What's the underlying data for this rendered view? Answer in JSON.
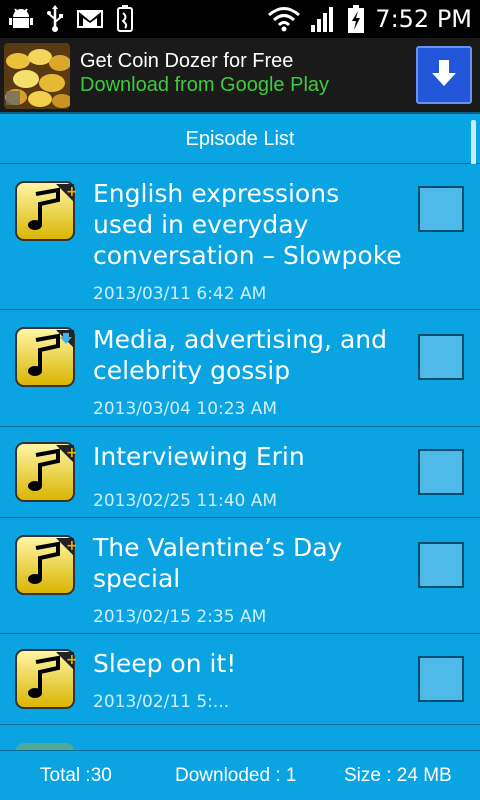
{
  "status_bar": {
    "time": "7:52 PM",
    "icons": [
      "android-debug-icon",
      "usb-icon",
      "gmail-icon",
      "battery-saver-icon",
      "wifi-icon",
      "signal-icon",
      "battery-charging-icon"
    ]
  },
  "ad": {
    "title": "Get Coin Dozer for Free",
    "subtitle": "Download from Google Play"
  },
  "header": {
    "title": "Episode List"
  },
  "episodes": [
    {
      "title": "English expressions used in everyday conversation – Slowpoke",
      "date": "2013/03/11 6:42 AM",
      "badge": "plus",
      "checked": false
    },
    {
      "title": "Media, advertising, and celebrity gossip",
      "date": "2013/03/04 10:23 AM",
      "badge": "download",
      "checked": false
    },
    {
      "title": "Interviewing Erin",
      "date": "2013/02/25 11:40 AM",
      "badge": "plus",
      "checked": false
    },
    {
      "title": "The Valentine’s Day special",
      "date": "2013/02/15 2:35 AM",
      "badge": "plus",
      "checked": false
    },
    {
      "title": "Sleep on it!",
      "date": "2013/02/11 5:...",
      "badge": "plus",
      "checked": false
    }
  ],
  "footer": {
    "total": "Total :30",
    "downloaded": "Downloded : 1",
    "size": "Size : 24 MB"
  },
  "colors": {
    "list_bg": "#0aa4e3",
    "ad_button": "#2357d9",
    "ad_subtitle": "#3fc93f"
  }
}
